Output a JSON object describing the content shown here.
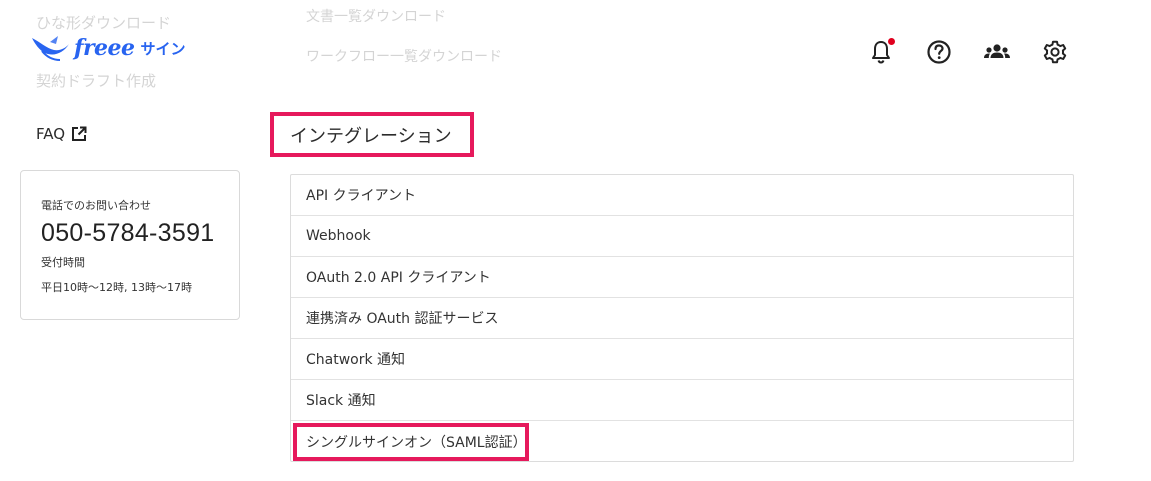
{
  "ghost_menu": {
    "left": [
      "ひな形ダウンロード",
      "契約ドラフト作成"
    ],
    "right": [
      "文書一覧ダウンロード",
      "ワークフロー一覧ダウンロード"
    ]
  },
  "brand": {
    "word": "freee",
    "product": "サイン",
    "color": "#2864f0"
  },
  "header": {
    "icons": [
      "bell-icon",
      "help-icon",
      "team-icon",
      "gear-icon"
    ],
    "notification_color": "#e0001e"
  },
  "sidebar": {
    "faq_label": "FAQ",
    "contact": {
      "label": "電話でのお問い合わせ",
      "phone": "050-5784-3591",
      "hours_label": "受付時間",
      "hours": "平日10時〜12時, 13時〜17時"
    }
  },
  "main": {
    "section_title": "インテグレーション",
    "highlight_color": "#e6195c",
    "items": [
      {
        "label": "API クライアント"
      },
      {
        "label": "Webhook"
      },
      {
        "label": "OAuth 2.0 API クライアント"
      },
      {
        "label": "連携済み OAuth 認証サービス"
      },
      {
        "label": "Chatwork 通知"
      },
      {
        "label": "Slack 通知"
      },
      {
        "label": "シングルサインオン（SAML認証）"
      }
    ]
  }
}
